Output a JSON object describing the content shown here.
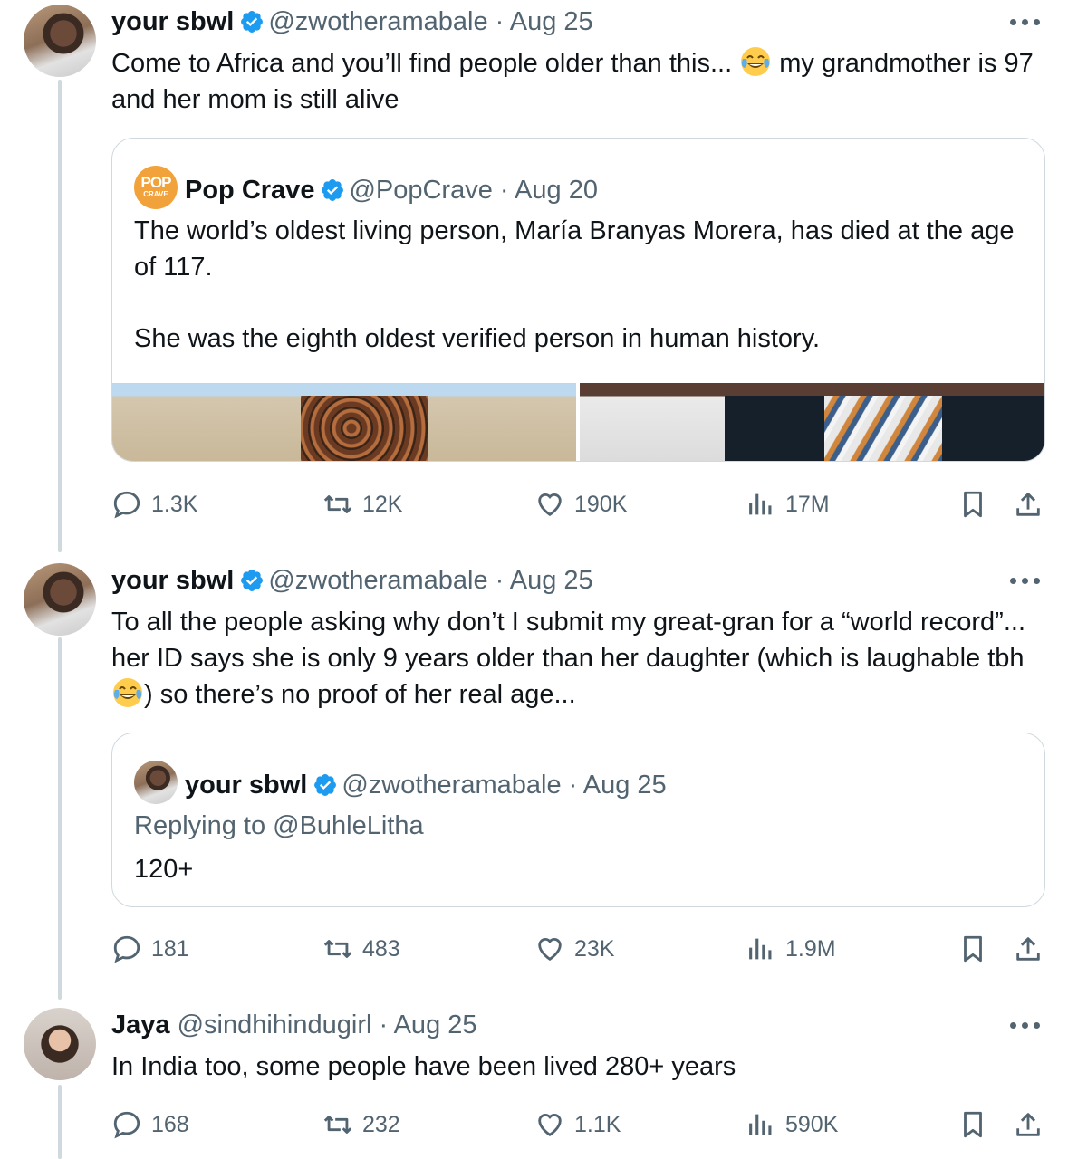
{
  "tweets": [
    {
      "name": "your sbwl",
      "handle": "@zwotheramabale",
      "sep": " · ",
      "date": "Aug 25",
      "text_before_emoji": "Come to Africa and you’ll find people older than this... ",
      "emoji": "tears-of-joy",
      "text_after_emoji": " my grandmother is 97 and her mom is still alive",
      "quote": {
        "name": "Pop Crave",
        "handle": "@PopCrave",
        "date": "Aug 20",
        "logo_text": "POP",
        "logo_subtext": "CRAVE",
        "para1": "The world’s oldest living person, María Branyas Morera, has died at the age of 117.",
        "para2": "She was the eighth oldest verified person in human history."
      },
      "stats": {
        "replies": "1.3K",
        "reposts": "12K",
        "likes": "190K",
        "views": "17M"
      }
    },
    {
      "name": "your sbwl",
      "handle": "@zwotheramabale",
      "sep": " · ",
      "date": "Aug 25",
      "text_before_emoji": "To all the people asking why don’t I submit my great-gran for a “world record”... her ID says she is only 9 years older than her daughter (which is laughable tbh",
      "emoji": "tears-of-joy",
      "text_after_emoji": ") so there’s no proof of her real age...",
      "quote": {
        "name": "your sbwl",
        "handle": "@zwotheramabale",
        "date": "Aug 25",
        "replying_to": "Replying to @BuhleLitha",
        "text": "120+"
      },
      "stats": {
        "replies": "181",
        "reposts": "483",
        "likes": "23K",
        "views": "1.9M"
      }
    },
    {
      "name": "Jaya",
      "handle": "@sindhihindugirl",
      "sep": " · ",
      "date": "Aug 25",
      "text": "In India too, some people have been lived 280+ years",
      "stats": {
        "replies": "168",
        "reposts": "232",
        "likes": "1.1K",
        "views": "590K"
      }
    }
  ],
  "colors": {
    "verified": "#1d9bf0",
    "secondary": "#536471",
    "border": "#cfd9de",
    "text": "#0f1419"
  }
}
